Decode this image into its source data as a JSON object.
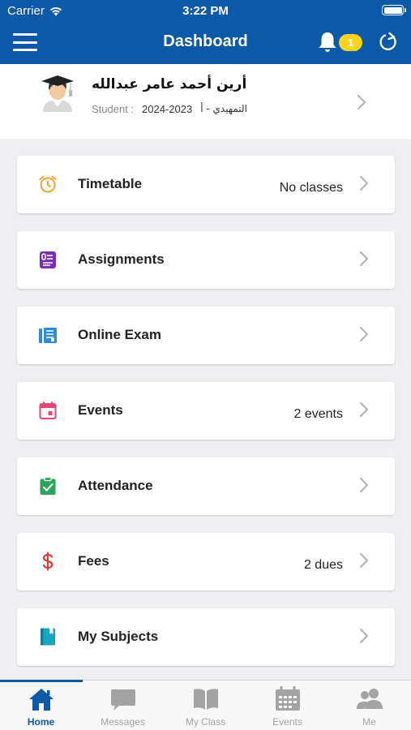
{
  "status_bar": {
    "carrier": "Carrier",
    "time": "3:22 PM"
  },
  "header": {
    "title": "Dashboard",
    "notification_count": "1"
  },
  "profile": {
    "name": "أرين أحمد عامر عبدالله",
    "role_label": "Student :",
    "academic_year": "2024-2023",
    "grade": "التمهيدي - أ"
  },
  "cards": [
    {
      "label": "Timetable",
      "value": "No classes",
      "icon": "alarm-clock-icon",
      "color": "#f2a531"
    },
    {
      "label": "Assignments",
      "value": "",
      "icon": "assignment-icon",
      "color": "#7a2fb0"
    },
    {
      "label": "Online Exam",
      "value": "",
      "icon": "online-exam-icon",
      "color": "#2f8ad8"
    },
    {
      "label": "Events",
      "value": "2 events",
      "icon": "calendar-icon",
      "color": "#e74576"
    },
    {
      "label": "Attendance",
      "value": "",
      "icon": "attendance-check-icon",
      "color": "#2aa55a"
    },
    {
      "label": "Fees",
      "value": "2 dues",
      "icon": "dollar-icon",
      "color": "#e53935"
    },
    {
      "label": "My Subjects",
      "value": "",
      "icon": "book-icon",
      "color": "#16a6c2"
    }
  ],
  "tabs": [
    {
      "label": "Home",
      "icon": "home-icon",
      "active": true
    },
    {
      "label": "Messages",
      "icon": "messages-icon",
      "active": false
    },
    {
      "label": "My Class",
      "icon": "open-book-icon",
      "active": false
    },
    {
      "label": "Events",
      "icon": "calendar-icon",
      "active": false
    },
    {
      "label": "Me",
      "icon": "people-icon",
      "active": false
    }
  ],
  "colors": {
    "primary": "#0c59a7",
    "badge": "#ffd21f",
    "background": "#efeff1",
    "tab_inactive": "#a3a3a3"
  }
}
